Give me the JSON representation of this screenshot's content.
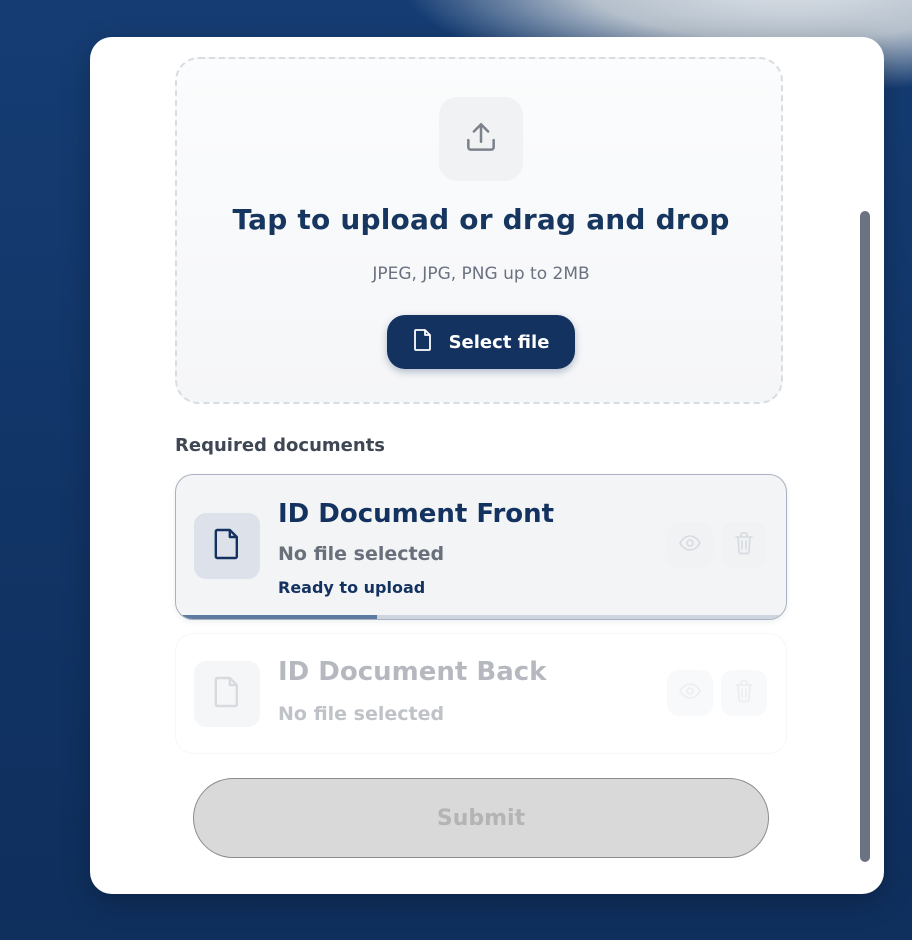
{
  "upload": {
    "title": "Tap to upload or drag and drop",
    "subtitle": "JPEG, JPG, PNG up to 2MB",
    "select_label": "Select file"
  },
  "documents": {
    "heading": "Required documents",
    "items": [
      {
        "title": "ID Document Front",
        "status": "No file selected",
        "note": "Ready to upload",
        "progress": 0.33,
        "state": "active"
      },
      {
        "title": "ID Document Back",
        "status": "No file selected",
        "state": "disabled"
      }
    ]
  },
  "submit_label": "Submit",
  "icons": {
    "upload": "upload-icon",
    "file": "file-icon",
    "view": "eye-icon",
    "delete": "trash-icon"
  },
  "colors": {
    "primary": "#14325f",
    "background": "#143b70",
    "card": "#ffffff",
    "submit_disabled": "#d9d9d9"
  }
}
